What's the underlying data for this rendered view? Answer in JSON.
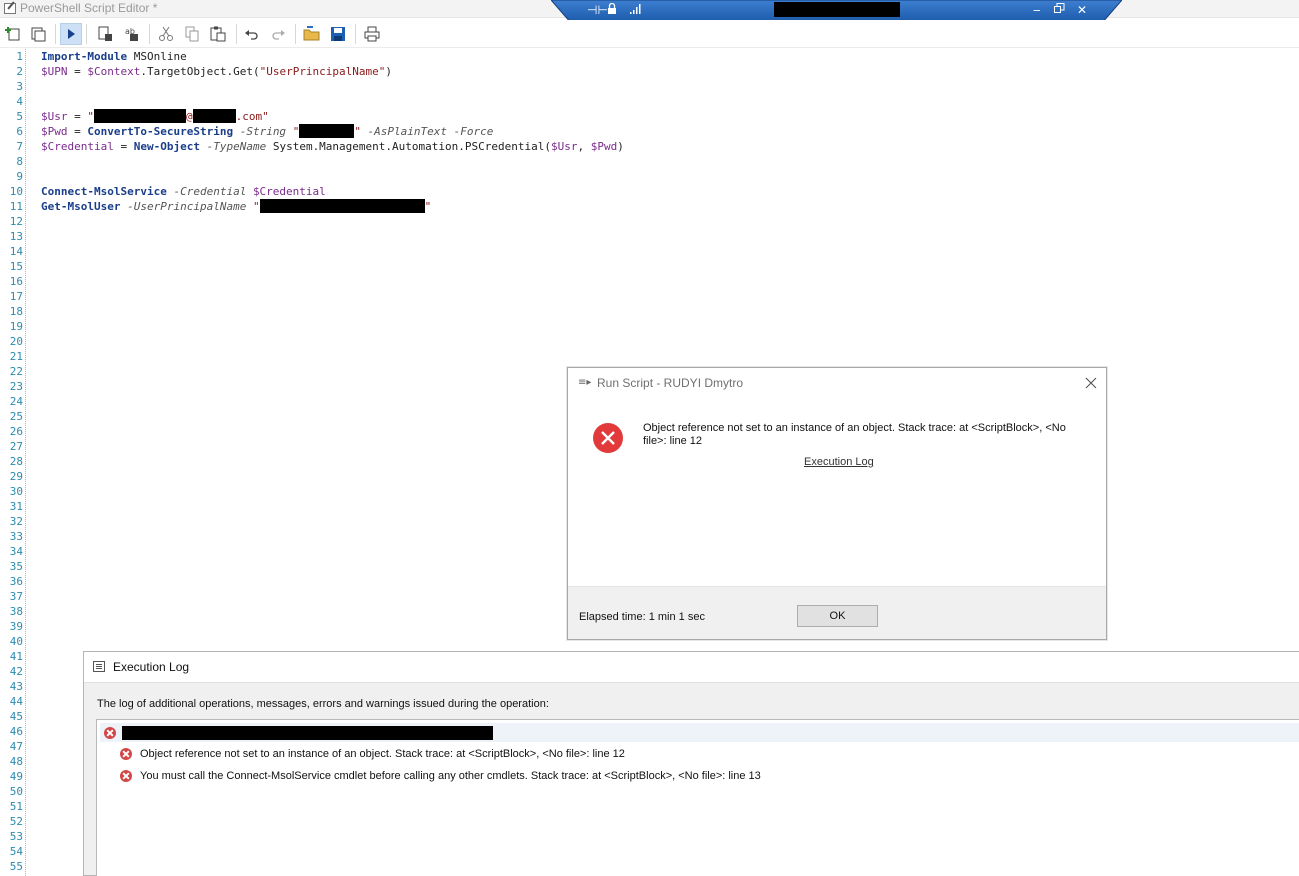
{
  "window": {
    "title": "PowerShell Script Editor *"
  },
  "toolbar": {
    "buttons": [
      "new-icon",
      "open-icon",
      "run-icon",
      "copy-script-icon",
      "compare-icon",
      "cut-icon",
      "copy-icon",
      "paste-icon",
      "undo-icon",
      "redo-icon",
      "open-folder-icon",
      "save-icon",
      "print-icon"
    ]
  },
  "editor": {
    "line_numbers": [
      "1",
      "2",
      "3",
      "4",
      "5",
      "6",
      "7",
      "8",
      "9",
      "10",
      "11",
      "12",
      "13",
      "14",
      "15",
      "16",
      "17",
      "18",
      "19",
      "20",
      "21",
      "22",
      "23",
      "24",
      "25",
      "26",
      "27",
      "28",
      "29",
      "30",
      "31",
      "32",
      "33",
      "34",
      "35",
      "36",
      "37",
      "38",
      "39",
      "40",
      "41",
      "42",
      "43",
      "44",
      "45",
      "46",
      "47",
      "48",
      "49",
      "50",
      "51",
      "52",
      "53",
      "54",
      "55"
    ],
    "lines": {
      "l1_a": "Import-Module",
      "l1_b": " MSOnline",
      "l2_a": "$UPN",
      "l2_b": " = ",
      "l2_c": "$Context",
      "l2_d": ".TargetObject.Get(",
      "l2_e": "\"UserPrincipalName\"",
      "l2_f": ")",
      "l5_a": "$Usr",
      "l5_b": " = ",
      "l5_c": "\"",
      "l5_d": "@",
      "l5_e": ".com\"",
      "l6_a": "$Pwd",
      "l6_b": " = ",
      "l6_c": "ConvertTo-SecureString",
      "l6_d": " -String ",
      "l6_e": "\"",
      "l6_f": "\"",
      "l6_g": " -AsPlainText -Force",
      "l7_a": "$Credential",
      "l7_b": " = ",
      "l7_c": "New-Object",
      "l7_d": " -TypeName ",
      "l7_e": "System.Management.Automation.PSCredential(",
      "l7_f": "$Usr",
      "l7_g": ", ",
      "l7_h": "$Pwd",
      "l7_i": ")",
      "l10_a": "Connect-MsolService",
      "l10_b": " -Credential ",
      "l10_c": "$Credential",
      "l11_a": "Get-MsolUser",
      "l11_b": " -UserPrincipalName ",
      "l11_c": "\"",
      "l11_d": "\""
    }
  },
  "dialog": {
    "title": "Run Script - RUDYI Dmytro",
    "message": "Object reference not set to an instance of an object. Stack trace: at <ScriptBlock>, <No file>: line 12",
    "link": "Execution Log",
    "elapsed": "Elapsed time: 1 min 1 sec",
    "ok_label": "OK"
  },
  "execution_log": {
    "title": "Execution Log",
    "description": "The log of additional operations, messages, errors and warnings issued during the operation:",
    "entries": [
      "Object reference not set to an instance of an object. Stack trace: at <ScriptBlock>, <No file>: line 12",
      "You must call the Connect-MsolService cmdlet before calling any other cmdlets. Stack trace: at <ScriptBlock>, <No file>: line 13"
    ]
  },
  "colors": {
    "error_red": "#e23a3a",
    "remote_bar_blue": "#1f63b8",
    "line_number_blue": "#2b8bb0"
  }
}
